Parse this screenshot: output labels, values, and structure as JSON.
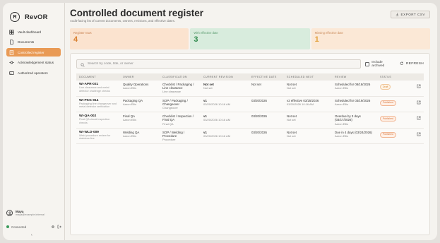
{
  "app": {
    "name": "RevOR"
  },
  "nav": {
    "items": [
      {
        "label": "Vault dashboard",
        "icon": "dashboard-icon",
        "active": false
      },
      {
        "label": "Documents",
        "icon": "document-icon",
        "active": false
      },
      {
        "label": "Controlled register",
        "icon": "register-icon",
        "active": true
      },
      {
        "label": "Acknowledgement status",
        "icon": "acknowledge-icon",
        "active": false
      },
      {
        "label": "Authorized operators",
        "icon": "operators-icon",
        "active": false
      }
    ]
  },
  "user": {
    "name": "Maya",
    "email": "maya@example.internal"
  },
  "status": {
    "label": "Connected"
  },
  "page": {
    "title": "Controlled document register",
    "subtitle": "Audit-facing list of current documents, owners, revisions, and effective dates.",
    "export_label": "EXPORT CSV"
  },
  "stats": [
    {
      "label": "Register rows",
      "value": "4"
    },
    {
      "label": "With effective date",
      "value": "3"
    },
    {
      "label": "Missing effective date",
      "value": "1"
    }
  ],
  "toolbar": {
    "search_placeholder": "Search by code, title, or owner",
    "include_archived": "Include archived",
    "refresh": "REFRESH"
  },
  "table": {
    "columns": [
      "DOCUMENT",
      "OWNER",
      "CLASSIFICATION",
      "CURRENT REVISION",
      "EFFECTIVE DATE",
      "SCHEDULED NEXT",
      "REVIEW",
      "STATUS"
    ],
    "rows": [
      {
        "code": "WI-APR-021",
        "title": "Line clearance and metal detector challenge checks",
        "owner": "Quality Operations",
        "owner_sub": "Aaron Ellis",
        "class": "Checklist / Packaging / Line clearance",
        "class_sub": "Line clearance",
        "rev": "Not set",
        "rev_sub": "Not set",
        "effective": "Not set",
        "next": "Not set",
        "next_sub": "Not set",
        "review": "Scheduled for 08/18/2026",
        "review_sub": "Aaron Ellis",
        "status": "Draft",
        "status_kind": "draft"
      },
      {
        "code": "WI-PKG-014",
        "title": "Packaging line changeover and metal detector verification",
        "owner": "Packaging QA",
        "owner_sub": "Aaron Ellis",
        "class": "SOP / Packaging / Changeover",
        "class_sub": "Changeover",
        "rev": "v1",
        "rev_sub": "03/20/2026 10:16 AM",
        "effective": "03/20/2026",
        "next": "v2 effective 03/25/2026",
        "next_sub": "03/20/2026 10:16 AM",
        "review": "Scheduled for 03/19/2026",
        "review_sub": "Aaron Ellis",
        "status": "Published",
        "status_kind": "pub"
      },
      {
        "code": "WI-QA-002",
        "title": "Final QA visual inspection checks",
        "owner": "Final QA",
        "owner_sub": "Aaron Ellis",
        "class": "Checklist / Inspection / Final QA",
        "class_sub": "Final QA",
        "rev": "v1",
        "rev_sub": "03/20/2026 10:16 AM",
        "effective": "03/20/2026",
        "next": "Not set",
        "next_sub": "Not set",
        "review": "Overdue by 3 days (03/17/2026)",
        "review_sub": "Aaron Ellis",
        "status": "Published",
        "status_kind": "pub"
      },
      {
        "code": "WI-WLD-009",
        "title": "Weld procedure review for stainless line",
        "owner": "Welding QA",
        "owner_sub": "Aaron Ellis",
        "class": "SOP / Welding / Procedure",
        "class_sub": "Procedure",
        "rev": "v1",
        "rev_sub": "03/20/2026 10:16 AM",
        "effective": "03/20/2026",
        "next": "Not set",
        "next_sub": "Not set",
        "review": "Due in 4 days (03/24/2026)",
        "review_sub": "Aaron Ellis",
        "status": "Published",
        "status_kind": "pub"
      }
    ]
  },
  "colors": {
    "accent": "#e99a55",
    "green": "#2f8a4c",
    "orange": "#d97f2e"
  }
}
